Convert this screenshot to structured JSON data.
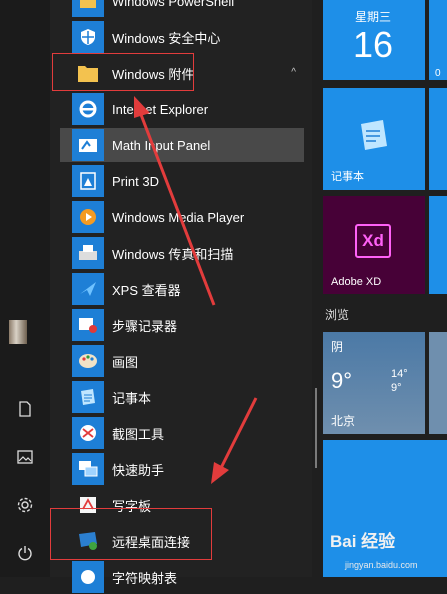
{
  "apps": [
    {
      "label": "Windows PowerShell",
      "icon": "folder-icon"
    },
    {
      "label": "Windows 安全中心",
      "icon": "shield-icon"
    },
    {
      "label": "Windows 附件",
      "icon": "folder-icon",
      "expanded": true
    },
    {
      "label": "Internet Explorer",
      "icon": "ie-icon"
    },
    {
      "label": "Math Input Panel",
      "icon": "math-input-icon",
      "selected": true
    },
    {
      "label": "Print 3D",
      "icon": "print3d-icon"
    },
    {
      "label": "Windows Media Player",
      "icon": "media-player-icon"
    },
    {
      "label": "Windows 传真和扫描",
      "icon": "fax-scan-icon"
    },
    {
      "label": "XPS 查看器",
      "icon": "xps-viewer-icon"
    },
    {
      "label": "步骤记录器",
      "icon": "steps-recorder-icon"
    },
    {
      "label": "画图",
      "icon": "paint-icon"
    },
    {
      "label": "记事本",
      "icon": "notepad-icon"
    },
    {
      "label": "截图工具",
      "icon": "snipping-tool-icon"
    },
    {
      "label": "快速助手",
      "icon": "quick-assist-icon"
    },
    {
      "label": "写字板",
      "icon": "wordpad-icon"
    },
    {
      "label": "远程桌面连接",
      "icon": "remote-desktop-icon"
    },
    {
      "label": "字符映射表",
      "icon": "charmap-icon"
    }
  ],
  "tiles": {
    "calendar": {
      "weekday": "星期三",
      "day": "16"
    },
    "notepad": {
      "label": "记事本"
    },
    "adobe_xd": {
      "label": "Adobe XD",
      "logo": "Xd"
    },
    "section_browse": "浏览",
    "weather": {
      "condition": "阴",
      "temp": "9°",
      "high": "14°",
      "low": "9°",
      "city": "北京"
    }
  },
  "watermark": {
    "brand": "Bai 经验",
    "url": "jingyan.baidu.com"
  },
  "colors": {
    "accent": "#1e8fe8",
    "selected": "#494949",
    "annotation": "#e23c3c",
    "xd": "#470137",
    "xd_pink": "#ff61f6"
  }
}
